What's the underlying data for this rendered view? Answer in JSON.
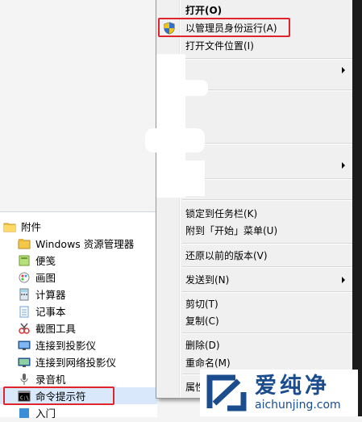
{
  "programs": {
    "folder": "附件",
    "items": [
      {
        "label": "Windows 资源管理器",
        "icon": "explorer-icon"
      },
      {
        "label": "便笺",
        "icon": "sticky-notes-icon"
      },
      {
        "label": "画图",
        "icon": "paint-icon"
      },
      {
        "label": "计算器",
        "icon": "calculator-icon"
      },
      {
        "label": "记事本",
        "icon": "notepad-icon"
      },
      {
        "label": "截图工具",
        "icon": "snipping-tool-icon"
      },
      {
        "label": "连接到投影仪",
        "icon": "projector-icon"
      },
      {
        "label": "连接到网络投影仪",
        "icon": "network-projector-icon"
      },
      {
        "label": "录音机",
        "icon": "sound-recorder-icon"
      },
      {
        "label": "命令提示符",
        "icon": "cmd-icon"
      },
      {
        "label": "入门",
        "icon": "getting-started-icon"
      }
    ]
  },
  "context_menu": {
    "open": "打开(O)",
    "run_as_admin": "以管理员身份运行(A)",
    "open_file_location": "打开文件位置(I)",
    "pin_taskbar": "锁定到任务栏(K)",
    "pin_start": "附到「开始」菜单(U)",
    "restore_previous": "还原以前的版本(V)",
    "send_to": "发送到(N)",
    "cut": "剪切(T)",
    "copy": "复制(C)",
    "delete": "删除(D)",
    "rename": "重命名(M)",
    "properties": "属性"
  },
  "watermark": {
    "title": "爱纯净",
    "url": "aichunjing.com"
  },
  "colors": {
    "highlight": "#e0242b",
    "selection": "#d9e8fb",
    "brand": "#1a4c8e"
  }
}
